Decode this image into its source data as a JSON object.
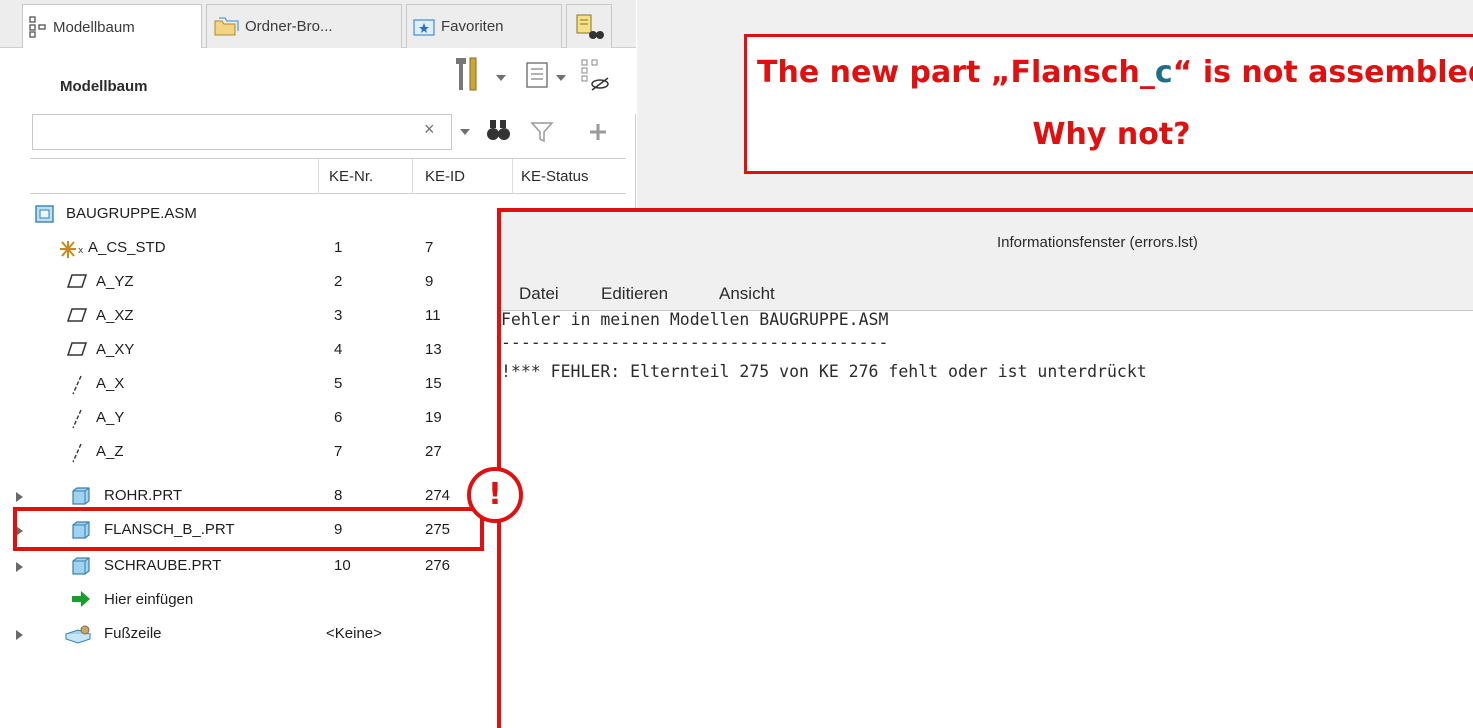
{
  "tabs": [
    {
      "label": "Modellbaum",
      "icon": "model-tree-icon",
      "active": true
    },
    {
      "label": "Ordner-Bro...",
      "icon": "folder-browser-icon",
      "active": false
    },
    {
      "label": "Favoriten",
      "icon": "favorites-icon",
      "active": false
    },
    {
      "label": "",
      "icon": "binoculars-docs-icon",
      "active": false
    }
  ],
  "header": {
    "title": "Modellbaum",
    "icons": [
      "settings-tools-icon",
      "tree-filter-list-icon",
      "show-hidden-icon"
    ]
  },
  "search": {
    "value": "",
    "placeholder": "",
    "clear_symbol": "×",
    "icons": [
      "binoculars-icon",
      "filter-icon",
      "plus-icon"
    ]
  },
  "columns": {
    "nr": "KE-Nr.",
    "id": "KE-ID",
    "status": "KE-Status"
  },
  "tree": [
    {
      "name": "BAUGRUPPE.ASM",
      "nr": "",
      "id": "",
      "icon": "assembly-icon",
      "expandable": false
    },
    {
      "name": "A_CS_STD",
      "nr": "1",
      "id": "7",
      "icon": "coordinate-system-icon",
      "expandable": false
    },
    {
      "name": "A_YZ",
      "nr": "2",
      "id": "9",
      "icon": "datum-plane-icon",
      "expandable": false
    },
    {
      "name": "A_XZ",
      "nr": "3",
      "id": "11",
      "icon": "datum-plane-icon",
      "expandable": false
    },
    {
      "name": "A_XY",
      "nr": "4",
      "id": "13",
      "icon": "datum-plane-icon",
      "expandable": false
    },
    {
      "name": "A_X",
      "nr": "5",
      "id": "15",
      "icon": "datum-axis-icon",
      "expandable": false
    },
    {
      "name": "A_Y",
      "nr": "6",
      "id": "19",
      "icon": "datum-axis-icon",
      "expandable": false
    },
    {
      "name": "A_Z",
      "nr": "7",
      "id": "27",
      "icon": "datum-axis-icon",
      "expandable": false
    },
    {
      "name": "ROHR.PRT",
      "nr": "8",
      "id": "274",
      "icon": "part-icon",
      "expandable": true
    },
    {
      "name": "FLANSCH_B_.PRT",
      "nr": "9",
      "id": "275",
      "icon": "part-icon",
      "expandable": true
    },
    {
      "name": "SCHRAUBE.PRT",
      "nr": "10",
      "id": "276",
      "icon": "part-icon",
      "expandable": true
    },
    {
      "name": "Hier einfügen",
      "nr": "",
      "id": "",
      "icon": "insert-here-arrow-icon",
      "expandable": false
    },
    {
      "name": "Fußzeile",
      "nr": "<Keine>",
      "id": "",
      "icon": "footer-icon",
      "expandable": true
    }
  ],
  "question": {
    "line1_before": "The new part „Flansch_",
    "line1_highlight": "c",
    "line1_after": "“ is not assembled",
    "line2": "Why not?"
  },
  "info_window": {
    "title": "Informationsfenster (errors.lst)",
    "menu": [
      "Datei",
      "Editieren",
      "Ansicht"
    ],
    "lines": [
      "Fehler in meinen Modellen BAUGRUPPE.ASM",
      "---------------------------------------",
      "!*** FEHLER: Elternteil 275 von KE 276 fehlt oder ist unterdrückt"
    ]
  },
  "warning_badge": "!",
  "colors": {
    "annotation_red": "#e01010",
    "highlight_teal": "#1f6f8b",
    "insert_green": "#1a9c2e",
    "part_blue": "#7ec3e6"
  }
}
